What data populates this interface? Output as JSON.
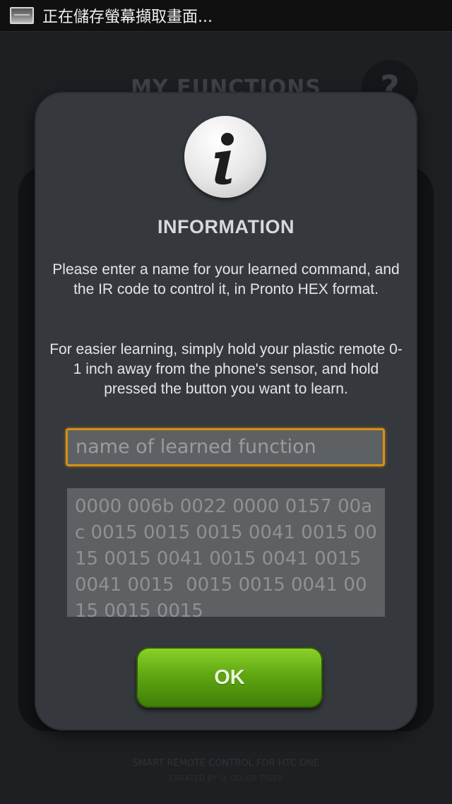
{
  "status_bar": {
    "notification_text": "正在儲存螢幕擷取畫面..."
  },
  "background": {
    "title": "MY FUNCTIONS",
    "help_label": "?",
    "footer_line1": "SMART REMOTE CONTROL FOR HTC ONE",
    "footer_line2": "CREATED BY @ COLOR TIGER"
  },
  "dialog": {
    "title": "INFORMATION",
    "paragraph1": "Please enter a name for your learned command, and the IR code to control it, in Pronto HEX format.",
    "paragraph2": "For easier learning, simply hold your plastic remote 0-1 inch away from the phone's sensor, and hold pressed the button you want to learn.",
    "name_input": {
      "placeholder": "name of learned function",
      "value": ""
    },
    "ir_code": "0000 006b 0022 0000 0157 00ac 0015 0015 0015 0041 0015 0015 0015 0041 0015 0041 0015 0041 0015  0015 0015 0041 0015 0015 0015",
    "ok_label": "OK"
  },
  "colors": {
    "accent_orange": "#d68f16",
    "ok_green": "#5fa812",
    "dialog_bg": "#35383c"
  },
  "icons": [
    "screenshot-icon",
    "info-icon",
    "help-icon"
  ]
}
